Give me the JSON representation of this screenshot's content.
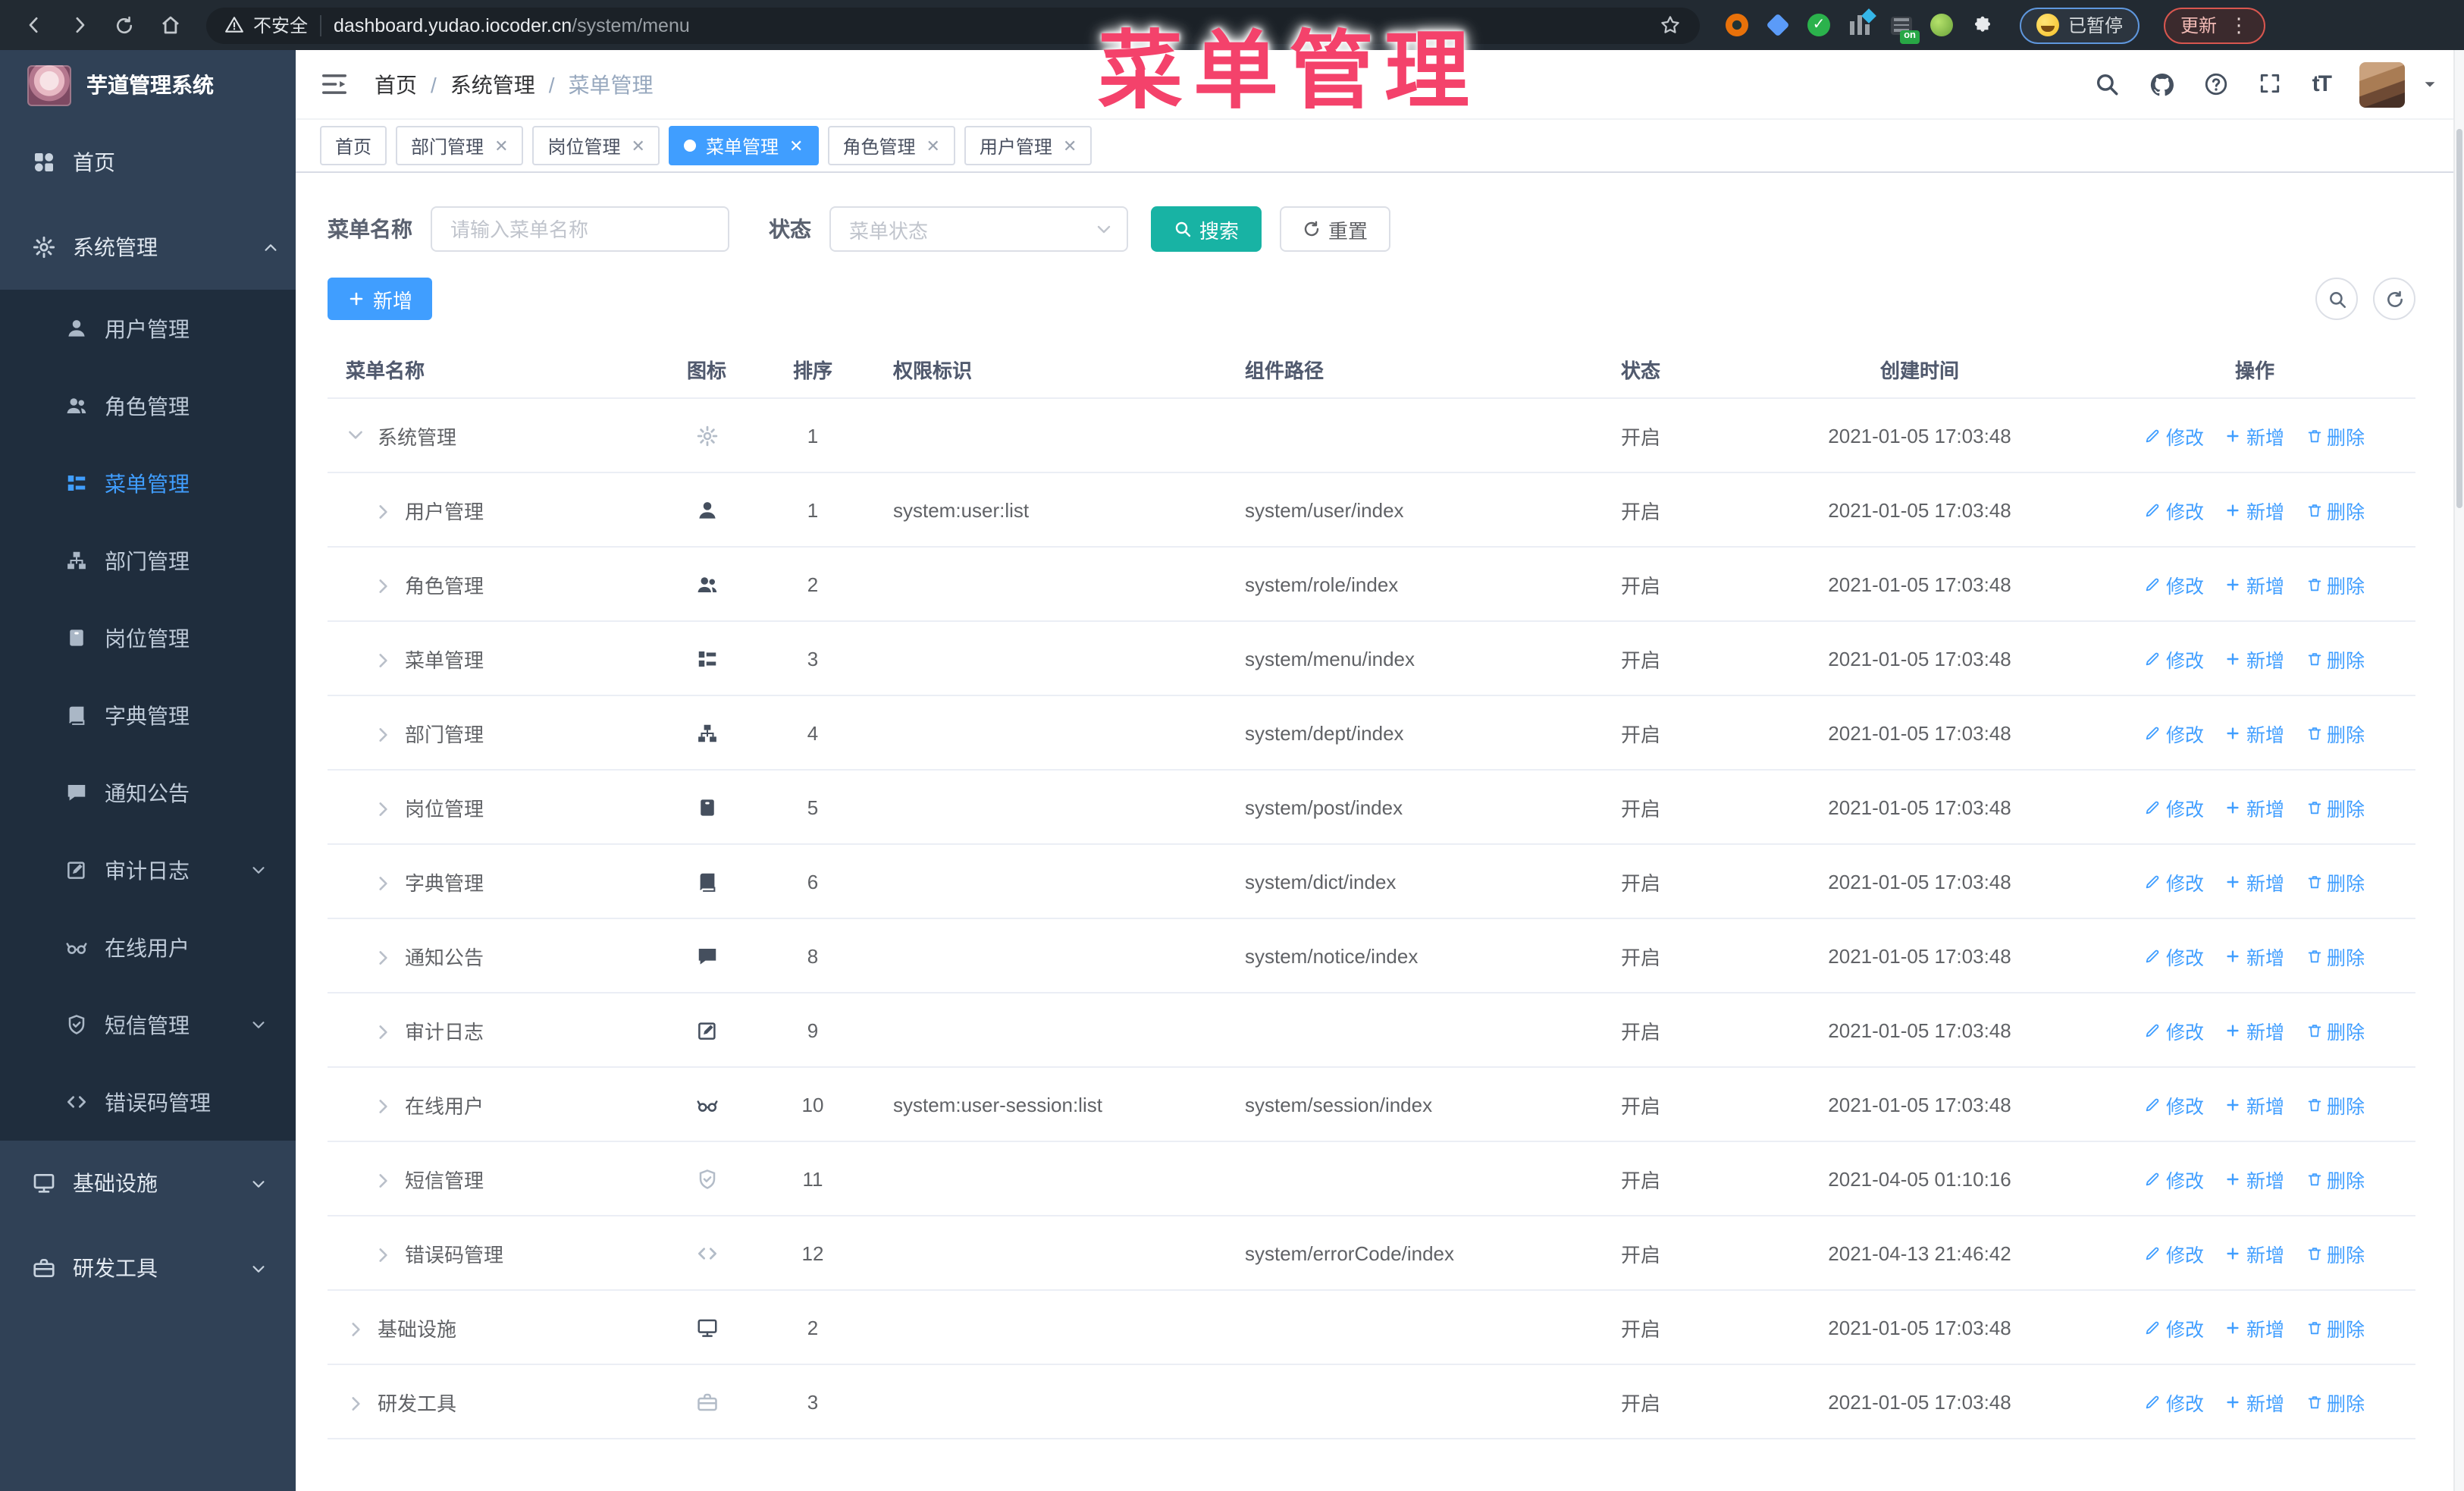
{
  "browser": {
    "security_label": "不安全",
    "url_host": "dashboard.yudao.iocoder.cn",
    "url_path": "/system/menu",
    "extensions": [
      "orange-ring",
      "blue-gem",
      "green-check",
      "columns-diamond",
      "rows-on-badge",
      "green-leaf",
      "puzzle"
    ],
    "on_badge": "on",
    "paused_label": "已暂停",
    "update_label": "更新"
  },
  "watermark": "菜单管理",
  "sidebar": {
    "app_title": "芋道管理系统",
    "items": [
      {
        "label": "首页",
        "icon": "dashboard",
        "level": 0
      },
      {
        "label": "系统管理",
        "icon": "gear",
        "level": 0,
        "chevron": "up",
        "active": false
      },
      {
        "label": "用户管理",
        "icon": "user",
        "level": 1
      },
      {
        "label": "角色管理",
        "icon": "users",
        "level": 1
      },
      {
        "label": "菜单管理",
        "icon": "menu",
        "level": 1,
        "active": true
      },
      {
        "label": "部门管理",
        "icon": "tree",
        "level": 1
      },
      {
        "label": "岗位管理",
        "icon": "badge",
        "level": 1
      },
      {
        "label": "字典管理",
        "icon": "book",
        "level": 1
      },
      {
        "label": "通知公告",
        "icon": "message",
        "level": 1
      },
      {
        "label": "审计日志",
        "icon": "edit",
        "level": 1,
        "chevron": "down"
      },
      {
        "label": "在线用户",
        "icon": "goggles",
        "level": 1
      },
      {
        "label": "短信管理",
        "icon": "shield",
        "level": 1,
        "chevron": "down"
      },
      {
        "label": "错误码管理",
        "icon": "code",
        "level": 1
      },
      {
        "label": "基础设施",
        "icon": "monitor",
        "level": 0,
        "chevron": "down"
      },
      {
        "label": "研发工具",
        "icon": "toolbox",
        "level": 0,
        "chevron": "down"
      }
    ]
  },
  "header": {
    "breadcrumb": [
      "首页",
      "系统管理",
      "菜单管理"
    ],
    "breadcrumb_separator": "/",
    "font_size_icon_text": "tT"
  },
  "tabs": [
    {
      "label": "首页",
      "closable": false,
      "active": false
    },
    {
      "label": "部门管理",
      "closable": true,
      "active": false
    },
    {
      "label": "岗位管理",
      "closable": true,
      "active": false
    },
    {
      "label": "菜单管理",
      "closable": true,
      "active": true
    },
    {
      "label": "角色管理",
      "closable": true,
      "active": false
    },
    {
      "label": "用户管理",
      "closable": true,
      "active": false
    }
  ],
  "filters": {
    "name_label": "菜单名称",
    "name_placeholder": "请输入菜单名称",
    "name_value": "",
    "status_label": "状态",
    "status_placeholder": "菜单状态",
    "search_label": "搜索",
    "reset_label": "重置"
  },
  "toolbar": {
    "add_label": "新增"
  },
  "table": {
    "columns": [
      "菜单名称",
      "图标",
      "排序",
      "权限标识",
      "组件路径",
      "状态",
      "创建时间",
      "操作"
    ],
    "action_labels": [
      "修改",
      "新增",
      "删除"
    ],
    "rows": [
      {
        "name": "系统管理",
        "icon": "gear",
        "muted_icon": true,
        "level": 0,
        "expanded": true,
        "sort": "1",
        "permission": "",
        "path": "",
        "status": "开启",
        "created": "2021-01-05 17:03:48"
      },
      {
        "name": "用户管理",
        "icon": "user",
        "level": 1,
        "sort": "1",
        "permission": "system:user:list",
        "path": "system/user/index",
        "status": "开启",
        "created": "2021-01-05 17:03:48"
      },
      {
        "name": "角色管理",
        "icon": "users",
        "level": 1,
        "sort": "2",
        "permission": "",
        "path": "system/role/index",
        "status": "开启",
        "created": "2021-01-05 17:03:48"
      },
      {
        "name": "菜单管理",
        "icon": "menu",
        "level": 1,
        "sort": "3",
        "permission": "",
        "path": "system/menu/index",
        "status": "开启",
        "created": "2021-01-05 17:03:48"
      },
      {
        "name": "部门管理",
        "icon": "tree",
        "level": 1,
        "sort": "4",
        "permission": "",
        "path": "system/dept/index",
        "status": "开启",
        "created": "2021-01-05 17:03:48"
      },
      {
        "name": "岗位管理",
        "icon": "badge",
        "level": 1,
        "sort": "5",
        "permission": "",
        "path": "system/post/index",
        "status": "开启",
        "created": "2021-01-05 17:03:48"
      },
      {
        "name": "字典管理",
        "icon": "book",
        "level": 1,
        "sort": "6",
        "permission": "",
        "path": "system/dict/index",
        "status": "开启",
        "created": "2021-01-05 17:03:48"
      },
      {
        "name": "通知公告",
        "icon": "message",
        "level": 1,
        "sort": "8",
        "permission": "",
        "path": "system/notice/index",
        "status": "开启",
        "created": "2021-01-05 17:03:48"
      },
      {
        "name": "审计日志",
        "icon": "edit",
        "level": 1,
        "sort": "9",
        "permission": "",
        "path": "",
        "status": "开启",
        "created": "2021-01-05 17:03:48"
      },
      {
        "name": "在线用户",
        "icon": "goggles",
        "level": 1,
        "sort": "10",
        "permission": "system:user-session:list",
        "path": "system/session/index",
        "status": "开启",
        "created": "2021-01-05 17:03:48"
      },
      {
        "name": "短信管理",
        "icon": "shield",
        "muted_icon": true,
        "level": 1,
        "sort": "11",
        "permission": "",
        "path": "",
        "status": "开启",
        "created": "2021-04-05 01:10:16"
      },
      {
        "name": "错误码管理",
        "icon": "code",
        "muted_icon": true,
        "level": 1,
        "sort": "12",
        "permission": "",
        "path": "system/errorCode/index",
        "status": "开启",
        "created": "2021-04-13 21:46:42"
      },
      {
        "name": "基础设施",
        "icon": "monitor",
        "level": 0,
        "sort": "2",
        "permission": "",
        "path": "",
        "status": "开启",
        "created": "2021-01-05 17:03:48"
      },
      {
        "name": "研发工具",
        "icon": "toolbox",
        "muted_icon": true,
        "level": 0,
        "sort": "3",
        "permission": "",
        "path": "",
        "status": "开启",
        "created": "2021-01-05 17:03:48"
      }
    ]
  },
  "colors": {
    "accent": "#409eff",
    "search_button": "#18b3a4",
    "watermark": "#f4426b",
    "sidebar_bg": "#304156",
    "submenu_bg": "#1f2d3d",
    "active_tab": "#409eff"
  }
}
